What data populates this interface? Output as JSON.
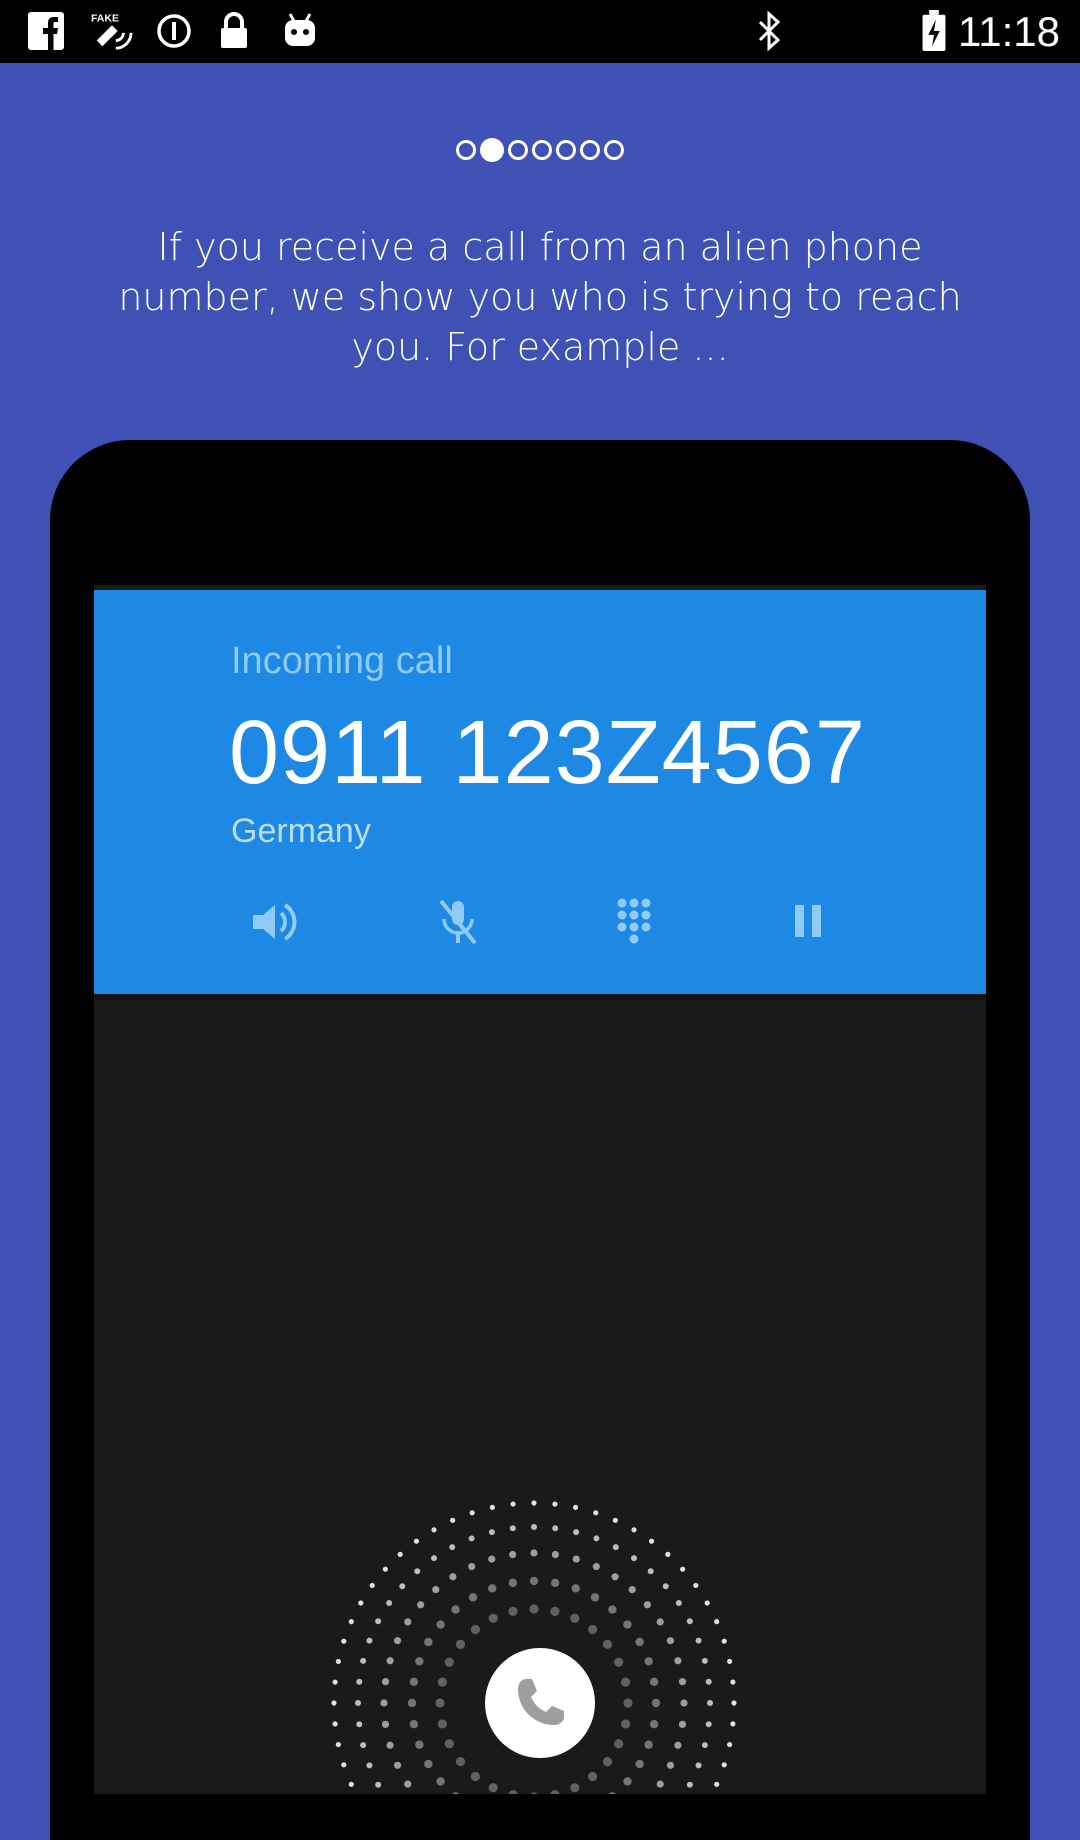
{
  "status_bar": {
    "time": "11:18",
    "left_icons": [
      "facebook-icon",
      "fake-gps-icon",
      "info-icon",
      "lock-icon",
      "android-icon"
    ],
    "right_icons": [
      "bluetooth-icon",
      "battery-icon"
    ]
  },
  "pager": {
    "count": 7,
    "active_index": 1
  },
  "description": "If you receive a call from an alien phone number, we show you who is trying to reach you. For example ...",
  "call": {
    "label": "Incoming call",
    "number": "0911 123Z4567",
    "country": "Germany",
    "buttons": [
      "speaker-icon",
      "mute-icon",
      "dialpad-icon",
      "pause-icon"
    ]
  },
  "colors": {
    "background": "#3F51B5",
    "call_header": "#1E88E5",
    "screen": "#1A1A1A"
  }
}
